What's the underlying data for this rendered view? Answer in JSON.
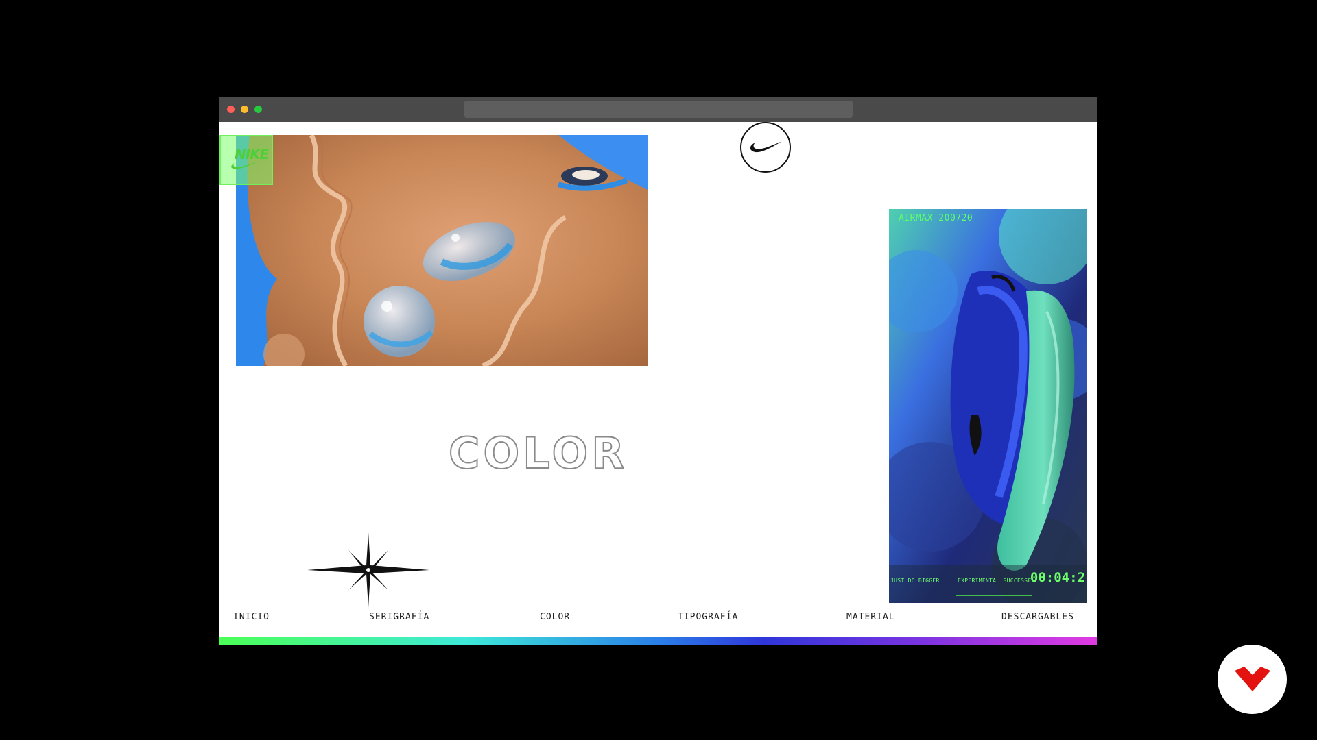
{
  "colors": {
    "window_red": "#ff5f56",
    "window_yellow": "#ffbd2e",
    "window_green": "#27c93f",
    "accent_green": "#5dff6a",
    "fab_red": "#e3140f"
  },
  "logo": {
    "text": "NIKE",
    "icon": "nike-swoosh-icon"
  },
  "main": {
    "section_title": "COLOR"
  },
  "video": {
    "tag": "AIRMAX 200720",
    "caption_left": "JUST DO BIGGER",
    "caption_mid": "EXPERIMENTAL SUCCESSFUL",
    "timer": "00:04:2"
  },
  "nav": {
    "items": [
      {
        "label": "INICIO"
      },
      {
        "label": "SERIGRAFÍA"
      },
      {
        "label": "COLOR"
      },
      {
        "label": "TIPOGRAFÍA"
      },
      {
        "label": "MATERIAL"
      },
      {
        "label": "DESCARGABLES"
      }
    ]
  },
  "icons": {
    "swoosh": "nike-swoosh-icon",
    "sparkle": "sparkle-star-icon",
    "fab": "domestika-logo-icon"
  }
}
